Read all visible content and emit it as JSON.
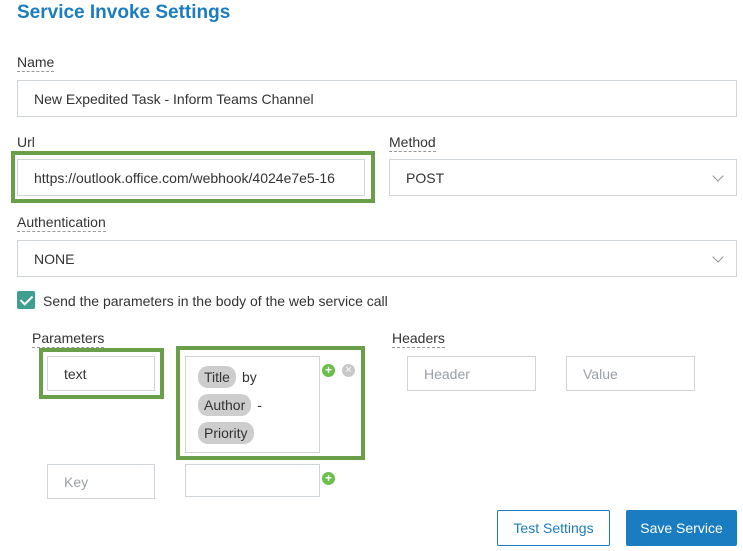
{
  "header": {
    "title": "Service Invoke Settings"
  },
  "name": {
    "label": "Name",
    "value": "New Expedited Task - Inform Teams Channel"
  },
  "url": {
    "label": "Url",
    "value": "https://outlook.office.com/webhook/4024e7e5-16"
  },
  "method": {
    "label": "Method",
    "value": "POST"
  },
  "authentication": {
    "label": "Authentication",
    "value": "NONE"
  },
  "send_in_body": {
    "checked": true,
    "label": "Send the parameters in the body of the web service call"
  },
  "parameters": {
    "label": "Parameters",
    "rows": [
      {
        "key": "text",
        "value_tokens": [
          {
            "pill": "Title",
            "text": "by"
          },
          {
            "pill": "Author",
            "text": "-"
          },
          {
            "pill": "Priority",
            "text": ""
          }
        ]
      }
    ],
    "new_key_placeholder": "Key"
  },
  "headers": {
    "label": "Headers",
    "header_placeholder": "Header",
    "value_placeholder": "Value"
  },
  "icons": {
    "add": "plus-circle-icon",
    "remove": "x-circle-icon",
    "dropdown": "chevron-down-icon"
  },
  "colors": {
    "accent": "#1a7cc1",
    "highlight": "#6a9f4a",
    "checkbox": "#3f9e8f",
    "add_icon": "#6abf4b"
  },
  "buttons": {
    "test": "Test Settings",
    "save": "Save Service"
  }
}
